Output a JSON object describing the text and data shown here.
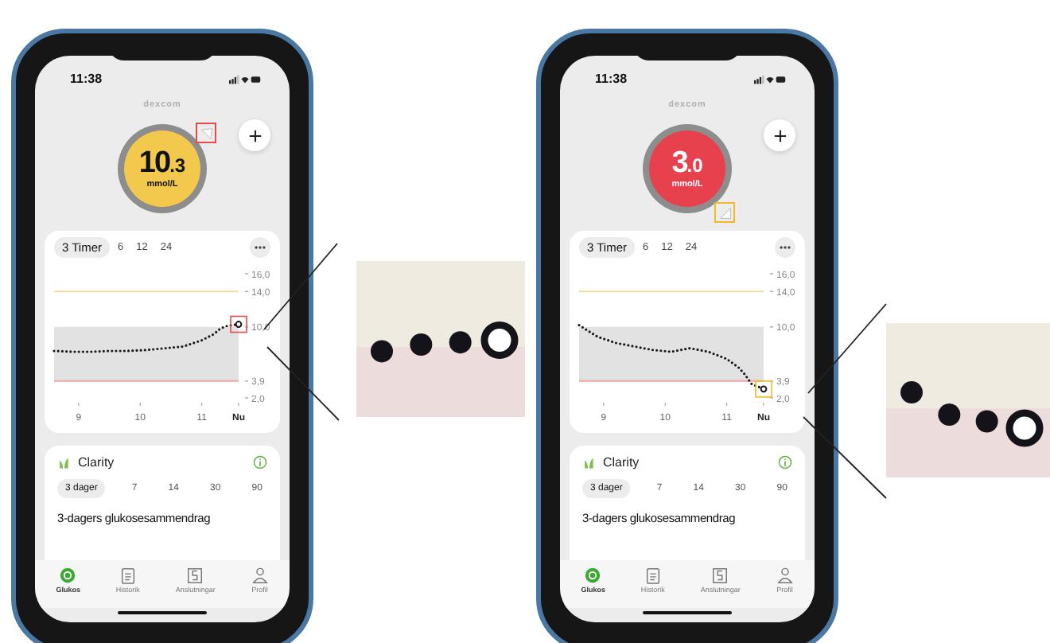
{
  "phones": [
    {
      "status_bar": {
        "time": "11:38"
      },
      "brand": "dexcom",
      "reading": {
        "whole": "10",
        "fraction": ".3",
        "unit": "mmol/L",
        "color": "#f2c94c",
        "trend_rising": true
      },
      "highlight": {
        "color": "#e84a4a"
      },
      "range_tabs": [
        {
          "label": "3 Timer",
          "selected": true
        },
        {
          "label": "6",
          "selected": false
        },
        {
          "label": "12",
          "selected": false
        },
        {
          "label": "24",
          "selected": false
        }
      ],
      "chart": {
        "chart_data": {
          "type": "line",
          "x": [
            8.6,
            8.9,
            9.2,
            9.5,
            9.8,
            10.1,
            10.4,
            10.7,
            11.0,
            11.2,
            11.3,
            11.4,
            11.5,
            11.6
          ],
          "series": [
            {
              "color": "#1a1a1a",
              "line_style": "dotted",
              "values": [
                7.3,
                7.2,
                7.2,
                7.3,
                7.3,
                7.4,
                7.6,
                7.8,
                8.5,
                9.2,
                9.8,
                10.1,
                10.2,
                10.3
              ]
            }
          ],
          "xlim": [
            8.6,
            11.6
          ],
          "ylim": [
            2,
            16
          ],
          "xticks": [
            9,
            10,
            11,
            {
              "value": 11.6,
              "label": "Nu"
            }
          ],
          "yticks": [
            {
              "value": 16,
              "label": "16,0"
            },
            {
              "value": 14,
              "label": "14,0"
            },
            {
              "value": 10,
              "label": "10,0"
            },
            {
              "value": 3.9,
              "label": "3,9"
            },
            {
              "value": 2,
              "label": "2,0"
            }
          ],
          "bands": [
            {
              "axis": "y",
              "from": 3.9,
              "to": 10,
              "color": "#e2e2e2"
            }
          ],
          "ref_lines": [
            {
              "axis": "y",
              "value": 14,
              "color": "#f3dca0"
            },
            {
              "axis": "y",
              "value": 3.9,
              "color": "#f2a3a3"
            }
          ]
        }
      },
      "clarity": {
        "title": "Clarity",
        "tabs": [
          {
            "label": "3 dager",
            "selected": true
          },
          {
            "label": "7",
            "selected": false
          },
          {
            "label": "14",
            "selected": false
          },
          {
            "label": "30",
            "selected": false
          },
          {
            "label": "90",
            "selected": false
          }
        ],
        "heading": "3-dagers glukosesammendrag"
      },
      "nav": [
        {
          "label": "Glukos",
          "selected": true
        },
        {
          "label": "Historik",
          "selected": false
        },
        {
          "label": "Anslutningar",
          "selected": false
        },
        {
          "label": "Profil",
          "selected": false
        }
      ]
    },
    {
      "status_bar": {
        "time": "11:38"
      },
      "brand": "dexcom",
      "reading": {
        "whole": "3",
        "fraction": ".0",
        "unit": "mmol/L",
        "color": "#e8414e",
        "trend_rising": false
      },
      "highlight": {
        "color": "#f2b92c"
      },
      "range_tabs": [
        {
          "label": "3 Timer",
          "selected": true
        },
        {
          "label": "6",
          "selected": false
        },
        {
          "label": "12",
          "selected": false
        },
        {
          "label": "24",
          "selected": false
        }
      ],
      "chart": {
        "chart_data": {
          "type": "line",
          "x": [
            8.6,
            8.9,
            9.2,
            9.5,
            9.8,
            10.1,
            10.4,
            10.7,
            11.0,
            11.2,
            11.3,
            11.4,
            11.5,
            11.6
          ],
          "series": [
            {
              "color": "#1a1a1a",
              "line_style": "dotted",
              "values": [
                10.2,
                8.9,
                8.2,
                7.8,
                7.4,
                7.2,
                7.6,
                7.2,
                6.4,
                5.4,
                4.6,
                3.6,
                3.3,
                3.0
              ]
            }
          ],
          "xlim": [
            8.6,
            11.6
          ],
          "ylim": [
            2,
            16
          ],
          "xticks": [
            9,
            10,
            11,
            {
              "value": 11.6,
              "label": "Nu"
            }
          ],
          "yticks": [
            {
              "value": 16,
              "label": "16,0"
            },
            {
              "value": 14,
              "label": "14,0"
            },
            {
              "value": 10,
              "label": "10,0"
            },
            {
              "value": 3.9,
              "label": "3,9"
            },
            {
              "value": 2,
              "label": "2,0"
            }
          ],
          "bands": [
            {
              "axis": "y",
              "from": 3.9,
              "to": 10,
              "color": "#e2e2e2"
            }
          ],
          "ref_lines": [
            {
              "axis": "y",
              "value": 14,
              "color": "#f3dca0"
            },
            {
              "axis": "y",
              "value": 3.9,
              "color": "#f2a3a3"
            }
          ]
        }
      },
      "clarity": {
        "title": "Clarity",
        "tabs": [
          {
            "label": "3 dager",
            "selected": true
          },
          {
            "label": "7",
            "selected": false
          },
          {
            "label": "14",
            "selected": false
          },
          {
            "label": "30",
            "selected": false
          },
          {
            "label": "90",
            "selected": false
          }
        ],
        "heading": "3-dagers glukosesammendrag"
      },
      "nav": [
        {
          "label": "Glukos",
          "selected": true
        },
        {
          "label": "Historik",
          "selected": false
        },
        {
          "label": "Anslutningar",
          "selected": false
        },
        {
          "label": "Profil",
          "selected": false
        }
      ]
    }
  ]
}
